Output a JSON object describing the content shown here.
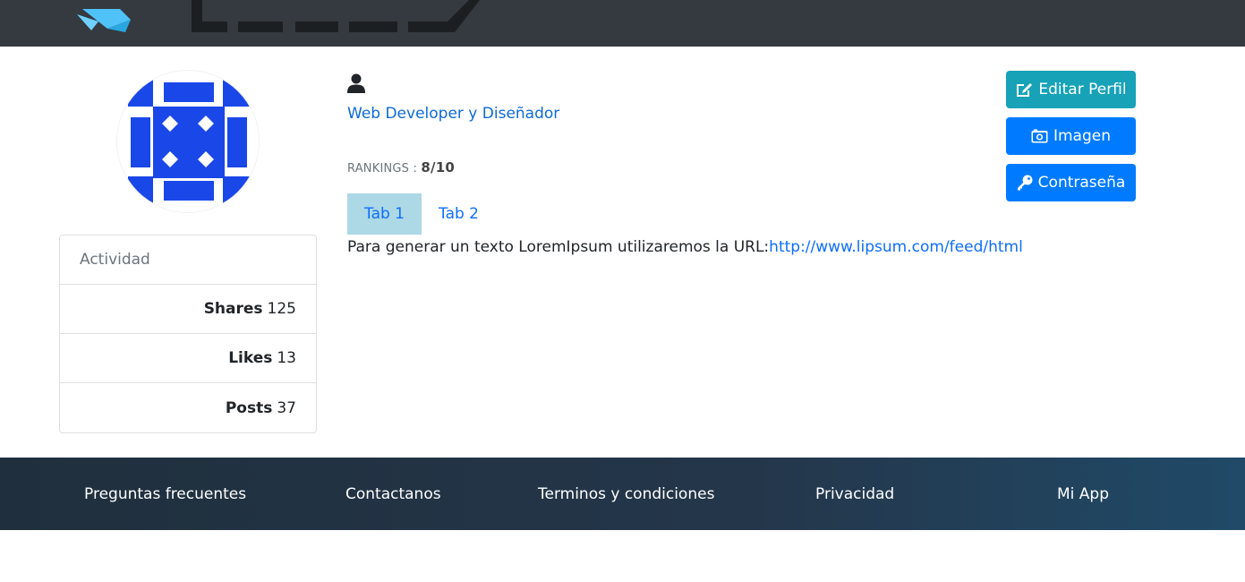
{
  "header": {
    "logo_icon": "brand-logo"
  },
  "profile": {
    "avatar_icon": "identicon-avatar",
    "user_icon": "user-icon",
    "role": "Web Developer y Diseñador",
    "rankings_label": "RANKINGS : ",
    "rankings_value": "8/10"
  },
  "activity": {
    "title": "Actividad",
    "stats": [
      {
        "label": "Shares",
        "value": "125"
      },
      {
        "label": "Likes",
        "value": "13"
      },
      {
        "label": "Posts",
        "value": "37"
      }
    ]
  },
  "tabs": [
    {
      "label": "Tab 1",
      "active": true
    },
    {
      "label": "Tab 2",
      "active": false
    }
  ],
  "tab_content": {
    "text": "Para generar un texto LoremIpsum utilizaremos la URL:",
    "link": "http://www.lipsum.com/feed/html"
  },
  "actions": {
    "edit": {
      "label": "Editar Perfil",
      "icon": "edit-icon"
    },
    "image": {
      "label": "Imagen",
      "icon": "camera-icon"
    },
    "password": {
      "label": "Contraseña",
      "icon": "key-icon"
    }
  },
  "footer": {
    "links": [
      "Preguntas frecuentes",
      "Contactanos",
      "Terminos y condiciones",
      "Privacidad",
      "Mi App"
    ]
  },
  "colors": {
    "topbar": "#343a40",
    "link_blue": "#0d6efd",
    "button_info": "#17a2b8",
    "button_primary": "#007bff",
    "tab_active": "#add8e6",
    "avatar_blue": "#1a47e8"
  }
}
